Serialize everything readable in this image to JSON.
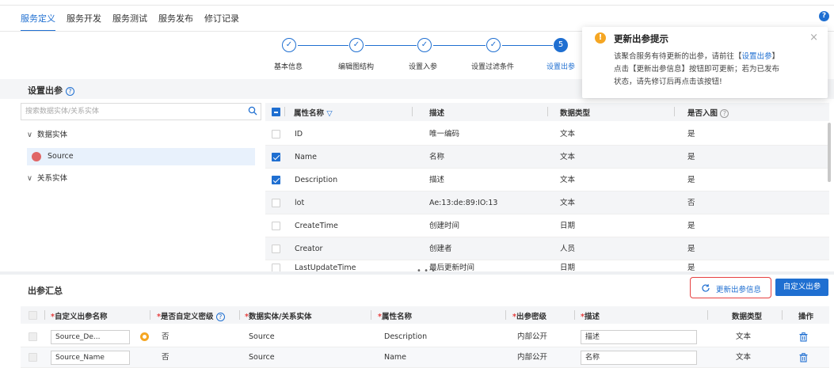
{
  "tabs": [
    {
      "label": "服务定义",
      "active": true
    },
    {
      "label": "服务开发"
    },
    {
      "label": "服务测试"
    },
    {
      "label": "服务发布"
    },
    {
      "label": "修订记录"
    }
  ],
  "help_glyph": "?",
  "steps": [
    {
      "label": "基本信息",
      "state": "done"
    },
    {
      "label": "编辑图结构",
      "state": "done"
    },
    {
      "label": "设置入参",
      "state": "done"
    },
    {
      "label": "设置过滤条件",
      "state": "done"
    },
    {
      "label": "设置出参",
      "number": "5",
      "state": "current"
    }
  ],
  "set_output": {
    "title": "设置出参",
    "question_glyph": "?",
    "search_placeholder": "搜索数据实体/关系实体"
  },
  "tree": [
    {
      "label": "数据实体",
      "type": "group"
    },
    {
      "label": "Source",
      "type": "leaf",
      "color": "#e06666"
    },
    {
      "label": "关系实体",
      "type": "group"
    }
  ],
  "attr_table": {
    "headers": {
      "name": "属性名称",
      "desc": "描述",
      "type": "数据类型",
      "in_graph": "是否入图"
    },
    "rows": [
      {
        "checked": false,
        "name": "ID",
        "desc": "唯一编码",
        "type": "文本",
        "in_graph": "是"
      },
      {
        "checked": true,
        "name": "Name",
        "desc": "名称",
        "type": "文本",
        "in_graph": "是"
      },
      {
        "checked": true,
        "name": "Description",
        "desc": "描述",
        "type": "文本",
        "in_graph": "是"
      },
      {
        "checked": false,
        "name": "lot",
        "desc": "Ae:13:de:89:IO:13",
        "type": "文本",
        "in_graph": "否"
      },
      {
        "checked": false,
        "name": "CreateTime",
        "desc": "创建时间",
        "type": "日期",
        "in_graph": "是"
      },
      {
        "checked": false,
        "name": "Creator",
        "desc": "创建者",
        "type": "人员",
        "in_graph": "是"
      },
      {
        "checked": false,
        "name": "LastUpdateTime",
        "desc": "最后更新时间",
        "type": "日期",
        "in_graph": "是"
      }
    ]
  },
  "popup": {
    "title": "更新出参提示",
    "line1_prefix": "该聚合服务有待更新的出参，请前往【",
    "line1_link": "设置出参",
    "line1_suffix": "】",
    "line2": "点击【更新出参信息】按钮即可更新；若为已发布",
    "line3": "状态，请先修订后再点击该按钮!",
    "close_glyph": "×",
    "warn_glyph": "!"
  },
  "summary": {
    "title": "出参汇总",
    "update_button": "更新出参信息",
    "custom_button": "自定义出参",
    "headers": {
      "custom_name": "自定义出参名称",
      "is_custom_level": "是否自定义密级",
      "entity": "数据实体/关系实体",
      "attr": "属性名称",
      "level": "出参密级",
      "desc": "描述",
      "type": "数据类型",
      "op": "操作"
    },
    "rows": [
      {
        "custom_name": "Source_De...",
        "warn": true,
        "is_custom": "否",
        "entity": "Source",
        "attr": "Description",
        "level": "内部公开",
        "desc": "描述",
        "type": "文本"
      },
      {
        "custom_name": "Source_Name",
        "warn": false,
        "is_custom": "否",
        "entity": "Source",
        "attr": "Name",
        "level": "内部公开",
        "desc": "名称",
        "type": "文本"
      }
    ]
  },
  "colors": {
    "accent": "#1f6fd1",
    "warning": "#f5a623",
    "danger": "#e64040"
  }
}
